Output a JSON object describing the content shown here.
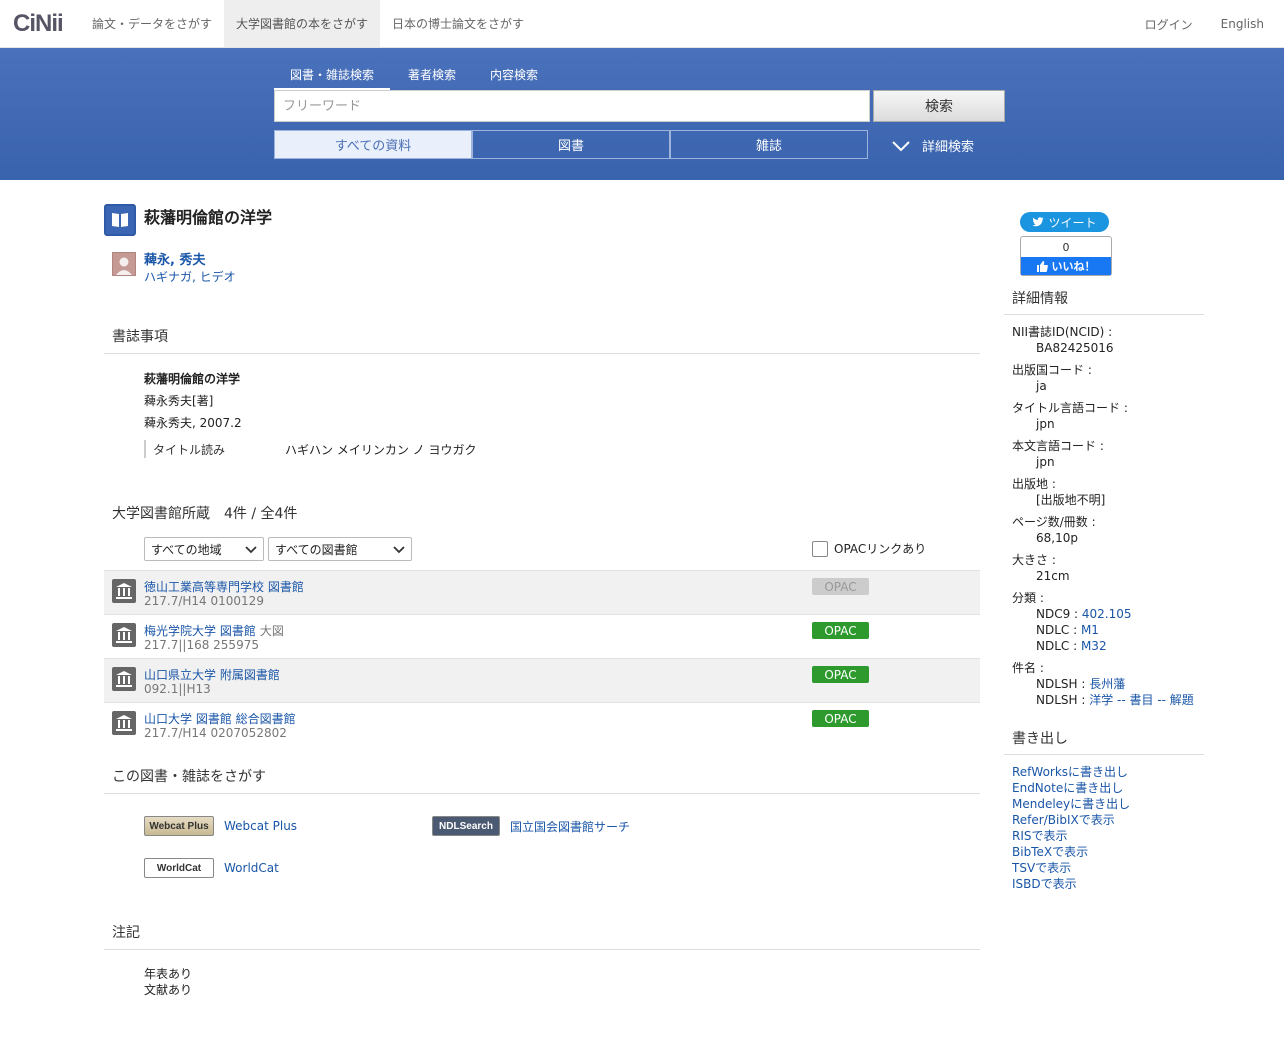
{
  "nav": {
    "logo": "CiNii",
    "tabs": [
      "論文・データをさがす",
      "大学図書館の本をさがす",
      "日本の博士論文をさがす"
    ],
    "login": "ログイン",
    "english": "English"
  },
  "search": {
    "tabs": [
      "図書・雑誌検索",
      "著者検索",
      "内容検索"
    ],
    "placeholder": "フリーワード",
    "button": "検索",
    "filters": [
      "すべての資料",
      "図書",
      "雑誌"
    ],
    "advanced": "詳細検索"
  },
  "book": {
    "title": "萩藩明倫館の洋学",
    "author_name": "薭永, 秀夫",
    "author_kana": "ハギナガ, ヒデオ"
  },
  "biblio": {
    "heading": "書誌事項",
    "title": "萩藩明倫館の洋学",
    "responsibility": "薭永秀夫[著]",
    "publication": "薭永秀夫, 2007.2",
    "reading_label": "タイトル読み",
    "reading_value": "ハギハン メイリンカン ノ ヨウガク"
  },
  "holdings": {
    "heading": "大学図書館所蔵　4件 / 全4件",
    "region_select": "すべての地域",
    "library_select": "すべての図書館",
    "opac_check": "OPACリンクあり",
    "opac_label": "OPAC",
    "rows": [
      {
        "name": "徳山工業高等専門学校 図書館",
        "sub": "",
        "call": "217.7/H14  0100129",
        "opac": false
      },
      {
        "name": "梅光学院大学 図書館",
        "sub": "大図",
        "call": "217.7||168  255975",
        "opac": true
      },
      {
        "name": "山口県立大学 附属図書館",
        "sub": "",
        "call": "092.1||H13",
        "opac": true
      },
      {
        "name": "山口大学 図書館 総合図書館",
        "sub": "",
        "call": "217.7/H14  0207052802",
        "opac": true
      }
    ]
  },
  "findit": {
    "heading": "この図書・雑誌をさがす",
    "webcat_badge": "Webcat Plus",
    "webcat": "Webcat Plus",
    "ndl_badge": "NDLSearch",
    "ndl": "国立国会図書館サーチ",
    "worldcat_badge": "WorldCat",
    "worldcat": "WorldCat"
  },
  "notes": {
    "heading": "注記",
    "lines": [
      "年表あり",
      "文献あり"
    ]
  },
  "side": {
    "tweet": "ツイート",
    "fb_count": "0",
    "fb_like": "いいね！",
    "details_heading": "詳細情報",
    "details": [
      {
        "label": "NII書誌ID(NCID) :",
        "value": "BA82425016"
      },
      {
        "label": "出版国コード :",
        "value": "ja"
      },
      {
        "label": "タイトル言語コード :",
        "value": "jpn"
      },
      {
        "label": "本文言語コード :",
        "value": "jpn"
      },
      {
        "label": "出版地 :",
        "value": "[出版地不明]"
      },
      {
        "label": "ページ数/冊数 :",
        "value": "68,10p"
      },
      {
        "label": "大きさ :",
        "value": "21cm"
      }
    ],
    "classification_label": "分類 :",
    "classification": [
      {
        "scheme": "NDC9 : ",
        "code": "402.105"
      },
      {
        "scheme": "NDLC : ",
        "code": "M1"
      },
      {
        "scheme": "NDLC : ",
        "code": "M32"
      }
    ],
    "subject_label": "件名 :",
    "subjects": [
      {
        "scheme": "NDLSH : ",
        "term": "長州藩"
      },
      {
        "scheme": "NDLSH : ",
        "term": "洋学 -- 書目 -- 解題"
      }
    ],
    "export_heading": "書き出し",
    "exports": [
      "RefWorksに書き出し",
      "EndNoteに書き出し",
      "Mendeleyに書き出し",
      "Refer/BibIXで表示",
      "RISで表示",
      "BibTeXで表示",
      "TSVで表示",
      "ISBDで表示"
    ]
  }
}
